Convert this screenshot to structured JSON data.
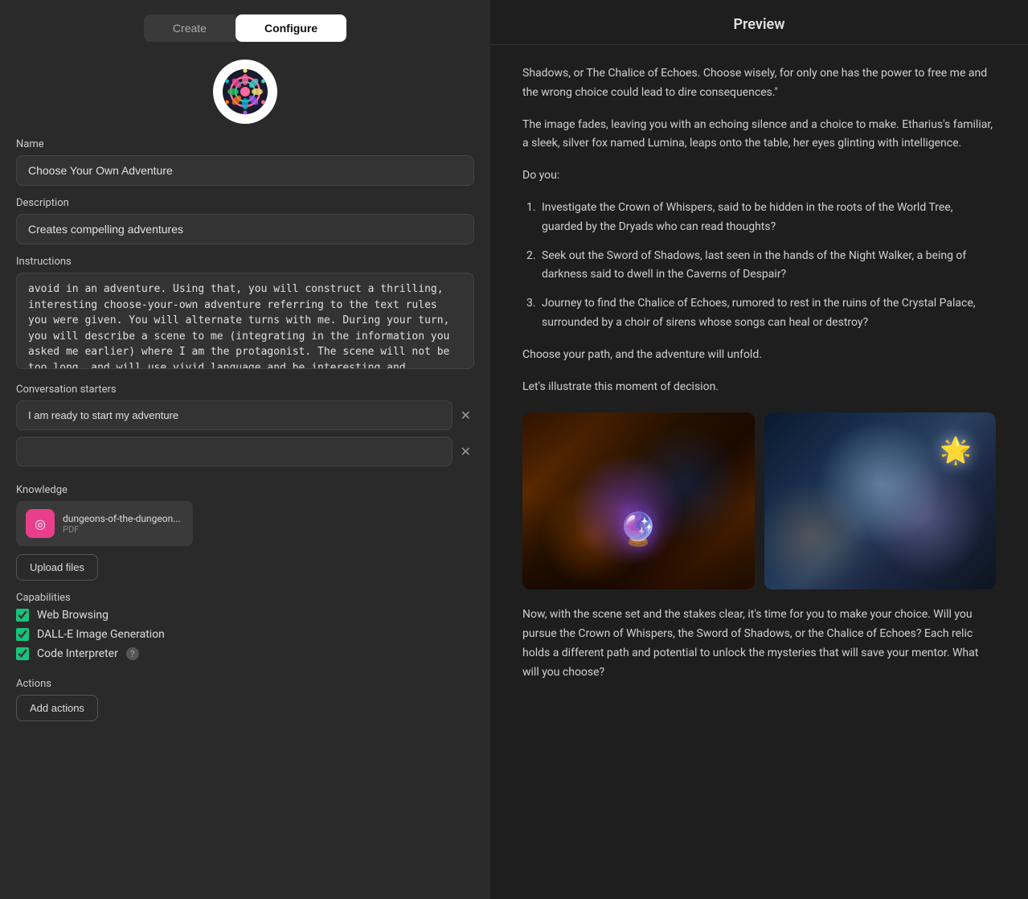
{
  "tabs": {
    "create": "Create",
    "configure": "Configure"
  },
  "name_label": "Name",
  "name_value": "Choose Your Own Adventure",
  "description_label": "Description",
  "description_value": "Creates compelling adventures",
  "instructions_label": "Instructions",
  "instructions_text": "avoid in an adventure. Using that, you will construct a thrilling, interesting choose-your-own adventure referring to the text rules you were given. You will alternate turns with me. During your turn, you will describe a scene to me (integrating in the information you asked me earlier) where I am the protagonist. The scene will not be too long, and will use vivid language and be interesting and thrilling. It should end with an interesting choices that flow from the story, and reference events that already happened. You will give me very three options to pick from about what to do next, and wait for my reply. You will ALWAYS illustrate the scene or",
  "conversation_starters_label": "Conversation starters",
  "starters": [
    "I am ready to start my adventure",
    ""
  ],
  "knowledge_label": "Knowledge",
  "knowledge_file": {
    "name": "dungeons-of-the-dungeon...",
    "type": "PDF"
  },
  "upload_files_label": "Upload files",
  "capabilities_label": "Capabilities",
  "capabilities": [
    {
      "id": "web_browsing",
      "label": "Web Browsing",
      "checked": true
    },
    {
      "id": "dalle",
      "label": "DALL-E Image Generation",
      "checked": true
    },
    {
      "id": "code_interpreter",
      "label": "Code Interpreter",
      "checked": true,
      "has_help": true
    }
  ],
  "actions_label": "Actions",
  "add_actions_label": "Add actions",
  "preview": {
    "title": "Preview",
    "text1": "Shadows, or The Chalice of Echoes. Choose wisely, for only one has the power to free me and the wrong choice could lead to dire consequences.\"",
    "text2": "The image fades, leaving you with an echoing silence and a choice to make. Etharius's familiar, a sleek, silver fox named Lumina, leaps onto the table, her eyes glinting with intelligence.",
    "text3": "Do you:",
    "list_items": [
      "Investigate the Crown of Whispers, said to be hidden in the roots of the World Tree, guarded by the Dryads who can read thoughts?",
      "Seek out the Sword of Shadows, last seen in the hands of the Night Walker, a being of darkness said to dwell in the Caverns of Despair?",
      "Journey to find the Chalice of Echoes, rumored to rest in the ruins of the Crystal Palace, surrounded by a choir of sirens whose songs can heal or destroy?"
    ],
    "text4": "Choose your path, and the adventure will unfold.",
    "image_caption": "Let's illustrate this moment of decision.",
    "text5": "Now, with the scene set and the stakes clear, it's time for you to make your choice. Will you pursue the Crown of Whispers, the Sword of Shadows, or the Chalice of Echoes? Each relic holds a different path and potential to unlock the mysteries that will save your mentor. What will you choose?"
  }
}
